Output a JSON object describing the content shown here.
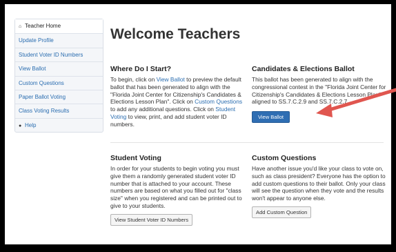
{
  "sidebar": {
    "items": [
      {
        "icon": "home-icon",
        "glyph": "⌂",
        "label": "Teacher Home"
      },
      {
        "label": "Update Profile"
      },
      {
        "label": "Student Voter ID Numbers"
      },
      {
        "label": "View Ballot"
      },
      {
        "label": "Custom Questions"
      },
      {
        "label": "Paper Ballot Voting"
      },
      {
        "label": "Class Voting Results"
      },
      {
        "icon": "help-icon",
        "glyph": "●",
        "label": "Help"
      }
    ]
  },
  "main": {
    "title": "Welcome Teachers",
    "where": {
      "heading": "Where Do I Start?",
      "t1": "To begin, click on ",
      "l1": "View Ballot",
      "t2": " to preview the default ballot that has been generated to align with the \"Florida Joint Center for Citizenship's Candidates & Elections Lesson Plan\". Click on ",
      "l2": "Custom Questions",
      "t3": " to add any additional questions. Click on ",
      "l3": "Student Voting",
      "t4": " to view, print, and add student voter ID numbers."
    },
    "candidates": {
      "heading": "Candidates & Elections Ballot",
      "text": "This ballot has been generated to align with the congressional contest in the \"Florida Joint Center for Citizenship's Candidates & Elections Lesson Plan\" aligned to SS.7.C.2.9 and SS.7.C.2.7.",
      "button": "View Ballot"
    },
    "student_voting": {
      "heading": "Student Voting",
      "text": "In order for your students to begin voting you must give them a randomly generated student voter ID number that is attached to your account. These numbers are based on what you filled out for \"class size\" when you registered and can be printed out to give to your students.",
      "button": "View Student Voter ID Numbers"
    },
    "custom": {
      "heading": "Custom Questions",
      "text": "Have another issue you'd like your class to vote on, such as class president? Everyone has the option to add custom questions to their ballot. Only your class will see the question when they vote and the results won't appear to anyone else.",
      "button": "Add Custom Question"
    }
  },
  "colors": {
    "link": "#2a6db0",
    "primary_button": "#2f6eb3",
    "annotation_arrow": "#e0564f"
  }
}
